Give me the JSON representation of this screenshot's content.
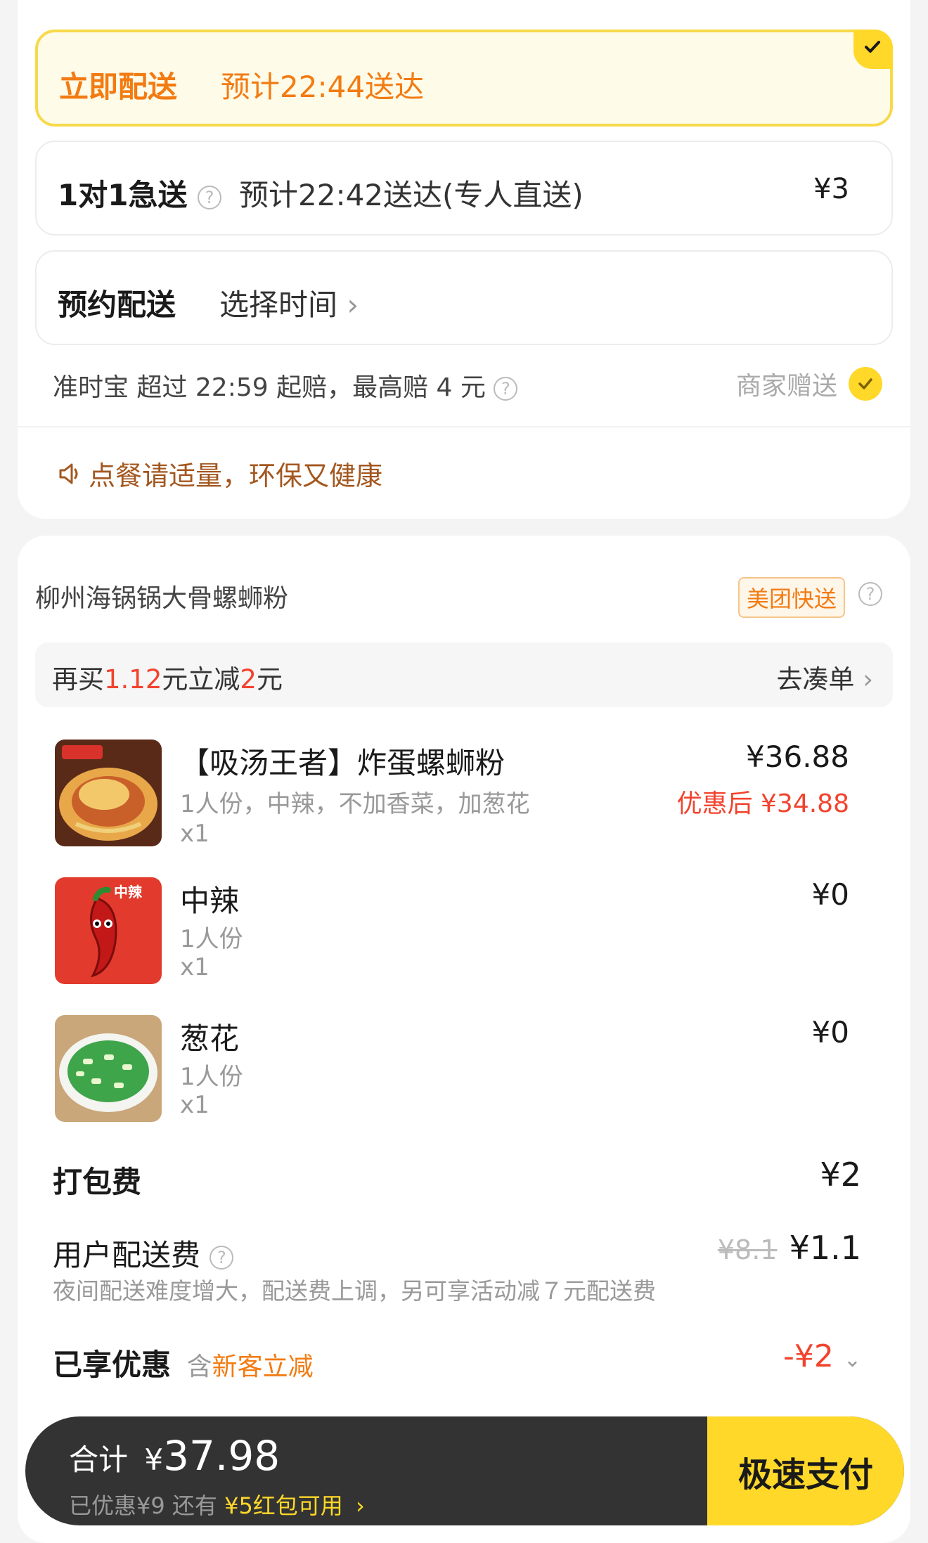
{
  "delivery": {
    "instant": {
      "title": "立即配送",
      "eta": "预计22:44送达"
    },
    "express": {
      "title": "1对1急送",
      "eta": "预计22:42送达(专人直送)",
      "price": "¥3"
    },
    "scheduled": {
      "title": "预约配送",
      "choose": "选择时间"
    }
  },
  "ontime": {
    "text": "准时宝   超过 22:59 起赔，最高赔 4 元",
    "gift": "商家赠送"
  },
  "eco_tip": "点餐请适量，环保又健康",
  "shop": {
    "name": "柳州海锅锅大骨螺蛳粉",
    "badge": "美团快送"
  },
  "promo": {
    "prefix": "再买",
    "amount": "1.12",
    "mid": "元立减",
    "off": "2",
    "suffix": "元",
    "action": "去凑单"
  },
  "items": [
    {
      "name": "【吸汤王者】炸蛋螺蛳粉",
      "desc": "1人份，中辣，不加香菜，加葱花",
      "qty": "x1",
      "price": "¥36.88",
      "after": "优惠后 ¥34.88"
    },
    {
      "name": "中辣",
      "desc": "1人份",
      "qty": "x1",
      "price": "¥0",
      "image_text": "中辣"
    },
    {
      "name": "葱花",
      "desc": "1人份",
      "qty": "x1",
      "price": "¥0"
    }
  ],
  "packaging": {
    "label": "打包费",
    "value": "¥2"
  },
  "delivery_fee": {
    "label": "用户配送费",
    "original": "¥8.1",
    "value": "¥1.1",
    "note": "夜间配送难度增大，配送费上调，另可享活动减７元配送费"
  },
  "discount": {
    "label": "已享优惠",
    "sub_prefix": "含",
    "sub_highlight": "新客立减",
    "value": "-¥2"
  },
  "checkout": {
    "total_label": "合计",
    "currency": "¥",
    "total": "37.98",
    "saved": "已优惠¥9  还有",
    "coupon": "¥5红包可用",
    "pay": "极速支付"
  },
  "colors": {
    "accent": "#ffd829",
    "red": "#f2432e",
    "orange": "#f27b12"
  }
}
